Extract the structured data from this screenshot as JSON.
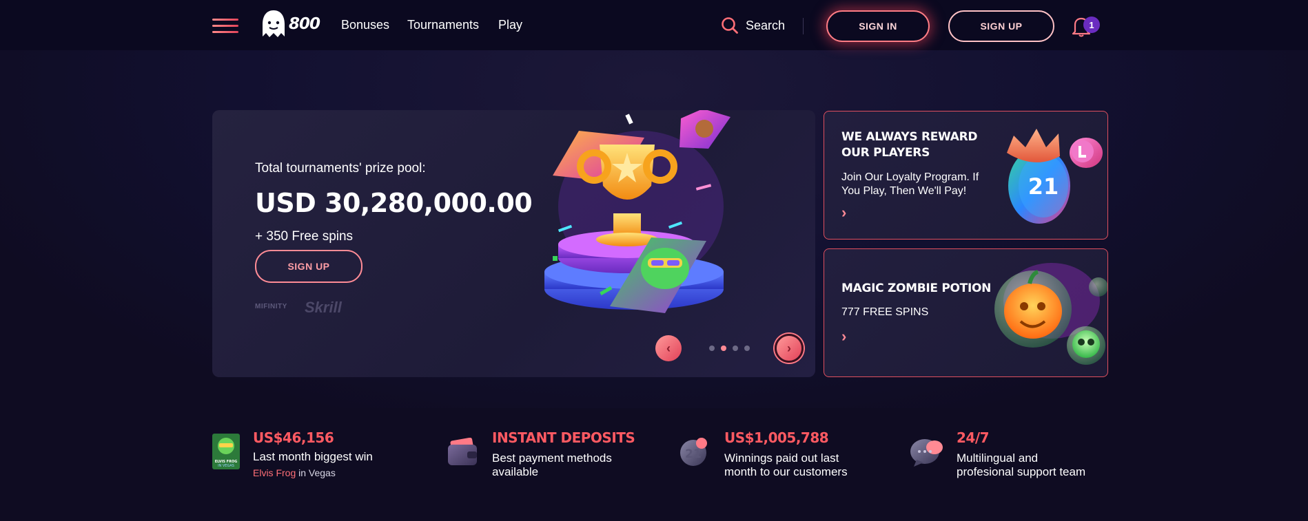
{
  "header": {
    "logo_text": "800",
    "nav": [
      "Bonuses",
      "Tournaments",
      "Play"
    ],
    "search_label": "Search",
    "sign_in": "SIGN IN",
    "sign_up": "SIGN UP",
    "notification_count": "1"
  },
  "hero": {
    "subtitle": "Total tournaments' prize pool:",
    "amount": "USD 30,280,000.00",
    "spins": "+ 350 Free spins",
    "cta": "SIGN UP",
    "payments": [
      "MIFINITY",
      "Skrill"
    ],
    "carousel": {
      "slides": 4,
      "active_index": 1
    }
  },
  "promo_cards": [
    {
      "title_line1": "WE ALWAYS REWARD",
      "title_line2": "OUR PLAYERS",
      "text_line1": "Join Our Loyalty Program. If",
      "text_line2": "You Play, Then We'll Pay!",
      "art_label": "21"
    },
    {
      "title_line1": "MAGIC ZOMBIE POTION",
      "text_line1": "777 FREE SPINS"
    }
  ],
  "stats": [
    {
      "value": "US$46,156",
      "text_line1": "Last month biggest win",
      "game": "Elvis Frog",
      "provider": "in Vegas",
      "thumb_line1": "ELVIS FROG",
      "thumb_line2": "IN VEGAS"
    },
    {
      "value": "INSTANT DEPOSITS",
      "text_line1": "Best payment methods",
      "text_line2": "available"
    },
    {
      "value": "US$1,005,788",
      "text_line1": "Winnings paid out last",
      "text_line2": "month to our customers",
      "icon_label": "21"
    },
    {
      "value": "24/7",
      "text_line1": "Multilingual and",
      "text_line2": "profesional support team"
    }
  ],
  "colors": {
    "accent": "#ff5a62",
    "accent_light": "#ff8a94",
    "background": "#0f0c22",
    "card_border": "#e0505f",
    "badge": "#6a2cc0"
  }
}
